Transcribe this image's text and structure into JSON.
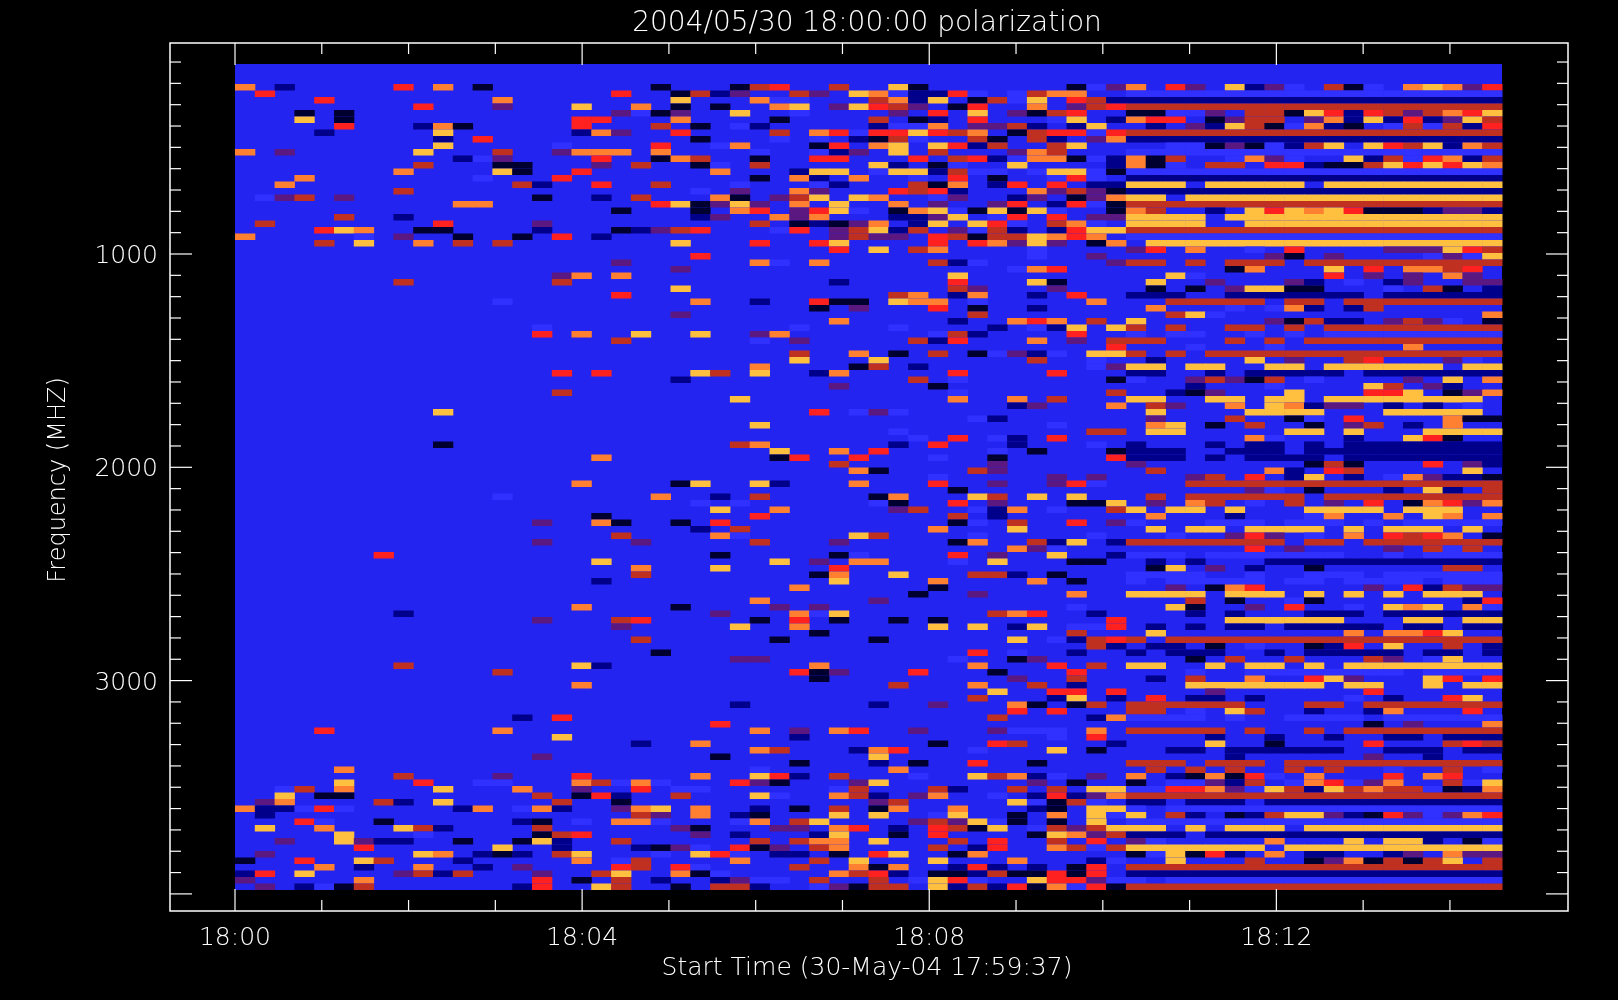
{
  "title": "2004/05/30 18:00:00 polarization",
  "y_axis": {
    "label": "Frequency (MHZ)",
    "ticks": [
      "1000",
      "2000",
      "3000"
    ]
  },
  "x_axis": {
    "label": "Start Time (30-May-04 17:59:37)",
    "ticks": [
      "18:00",
      "18:04",
      "18:08",
      "18:12"
    ]
  }
}
